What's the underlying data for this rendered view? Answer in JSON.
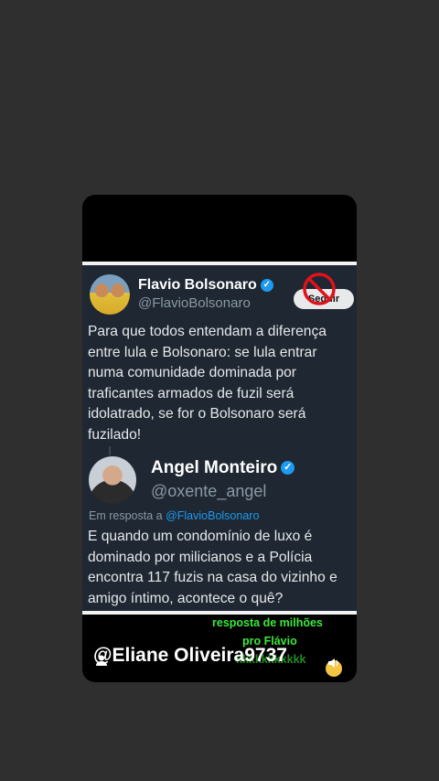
{
  "tweet1": {
    "name": "Flavio Bolsonaro",
    "handle": "@FlavioBolsonaro",
    "follow_label": "Seguir",
    "text": "Para que todos entendam a diferença entre lula e Bolsonaro: se lula entrar numa comunidade dominada por traficantes armados de fuzil será idolatrado, se for o Bolsonaro será fuzilado!"
  },
  "tweet2": {
    "name": "Angel Monteiro",
    "handle": "@oxente_angel",
    "reply_prefix": "Em resposta a",
    "reply_to": "@FlavioBolsonaro",
    "text": "E quando um condomínio de luxo é dominado por milicianos e a Polícia encontra 117 fuzis na casa do vizinho e amigo íntimo, acontece o quê?"
  },
  "overlay": {
    "line1": "resposta de milhões",
    "line2": "pro Flávio",
    "line3": "kkkkkkkkkkk"
  },
  "watermark": "@Eliane Oliveira9737",
  "colors": {
    "background": "#2f2f2f",
    "tweet_bg": "#1e2732",
    "accent": "#1d9bf0",
    "overlay_text": "#3be83b"
  }
}
